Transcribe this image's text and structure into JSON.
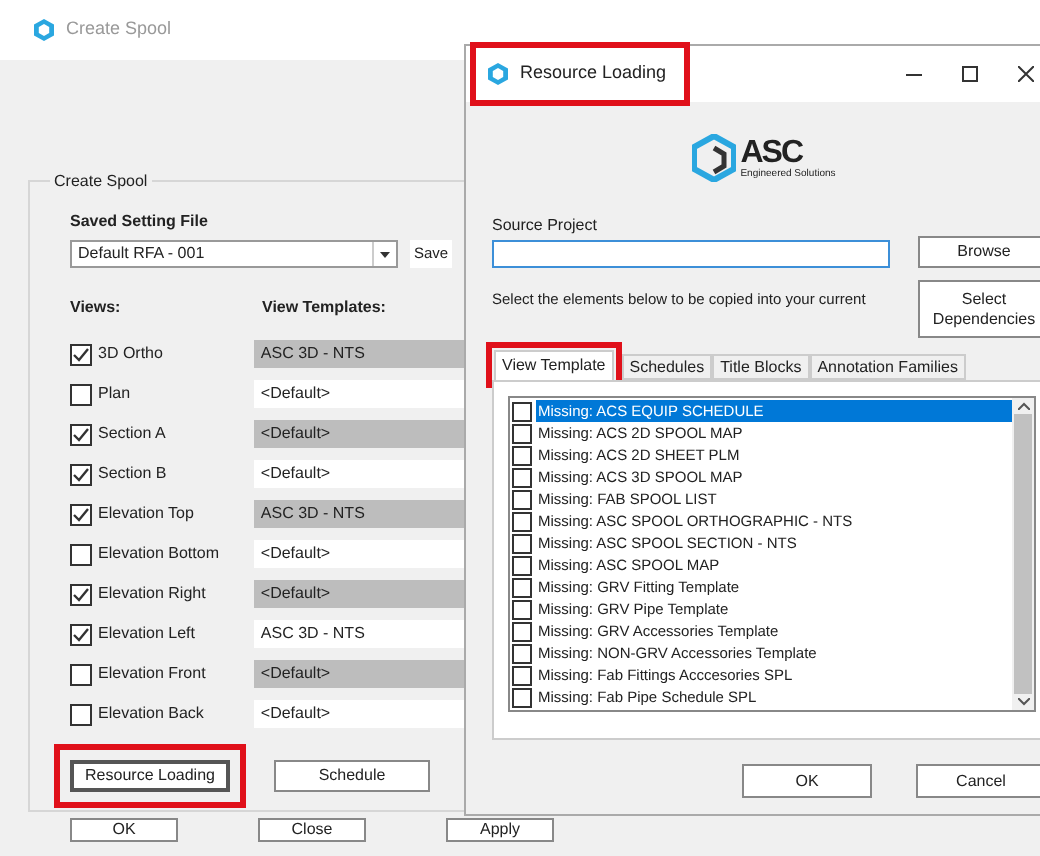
{
  "back_window": {
    "title": "Create Spool",
    "group_title": "Create Spool",
    "saved_setting_label": "Saved Setting File",
    "saved_setting_value": "Default RFA - 001",
    "save_button": "Save",
    "views_header": "Views:",
    "templates_header": "View Templates:",
    "views": [
      {
        "label": "3D Ortho",
        "checked": true,
        "template": "ASC 3D - NTS",
        "shaded": true
      },
      {
        "label": "Plan",
        "checked": false,
        "template": "<Default>",
        "shaded": false
      },
      {
        "label": "Section A",
        "checked": true,
        "template": "<Default>",
        "shaded": true
      },
      {
        "label": "Section B",
        "checked": true,
        "template": "<Default>",
        "shaded": false
      },
      {
        "label": "Elevation Top",
        "checked": true,
        "template": "ASC 3D - NTS",
        "shaded": true
      },
      {
        "label": "Elevation Bottom",
        "checked": false,
        "template": "<Default>",
        "shaded": false
      },
      {
        "label": "Elevation Right",
        "checked": true,
        "template": "<Default>",
        "shaded": true
      },
      {
        "label": "Elevation Left",
        "checked": true,
        "template": "ASC 3D - NTS",
        "shaded": false
      },
      {
        "label": "Elevation Front",
        "checked": false,
        "template": "<Default>",
        "shaded": true
      },
      {
        "label": "Elevation Back",
        "checked": false,
        "template": "<Default>",
        "shaded": false
      }
    ],
    "action_buttons": [
      "Resource Loading",
      "Schedule"
    ],
    "footer_buttons": [
      "OK",
      "Close",
      "Apply"
    ]
  },
  "dialog": {
    "title": "Resource Loading",
    "logo_text": "ASC",
    "logo_subtext": "Engineered Solutions",
    "source_label": "Source Project",
    "browse_button": "Browse",
    "instruction": "Select the elements below to be copied  into your current",
    "dependencies_button": "Select Dependencies",
    "tabs": [
      {
        "label": "View Template",
        "selected": true
      },
      {
        "label": "Schedules",
        "selected": false
      },
      {
        "label": "Title Blocks",
        "selected": false
      },
      {
        "label": "Annotation Families",
        "selected": false
      }
    ],
    "items": [
      {
        "label": "Missing: ACS EQUIP SCHEDULE",
        "checked": false,
        "selected": true
      },
      {
        "label": "Missing: ACS 2D SPOOL MAP",
        "checked": false,
        "selected": false
      },
      {
        "label": "Missing: ACS 2D SHEET PLM",
        "checked": false,
        "selected": false
      },
      {
        "label": "Missing: ACS 3D SPOOL MAP",
        "checked": false,
        "selected": false
      },
      {
        "label": "Missing: FAB SPOOL LIST",
        "checked": false,
        "selected": false
      },
      {
        "label": "Missing: ASC SPOOL ORTHOGRAPHIC - NTS",
        "checked": false,
        "selected": false
      },
      {
        "label": "Missing: ASC SPOOL SECTION - NTS",
        "checked": false,
        "selected": false
      },
      {
        "label": "Missing: ASC SPOOL MAP",
        "checked": false,
        "selected": false
      },
      {
        "label": "Missing: GRV Fitting Template",
        "checked": false,
        "selected": false
      },
      {
        "label": "Missing: GRV Pipe Template",
        "checked": false,
        "selected": false
      },
      {
        "label": "Missing: GRV Accessories Template",
        "checked": false,
        "selected": false
      },
      {
        "label": "Missing: NON-GRV Accessories Template",
        "checked": false,
        "selected": false
      },
      {
        "label": "Missing: Fab Fittings Acccesories SPL",
        "checked": false,
        "selected": false
      },
      {
        "label": "Missing: Fab Pipe Schedule SPL",
        "checked": false,
        "selected": false
      }
    ],
    "ok_button": "OK",
    "cancel_button": "Cancel"
  }
}
